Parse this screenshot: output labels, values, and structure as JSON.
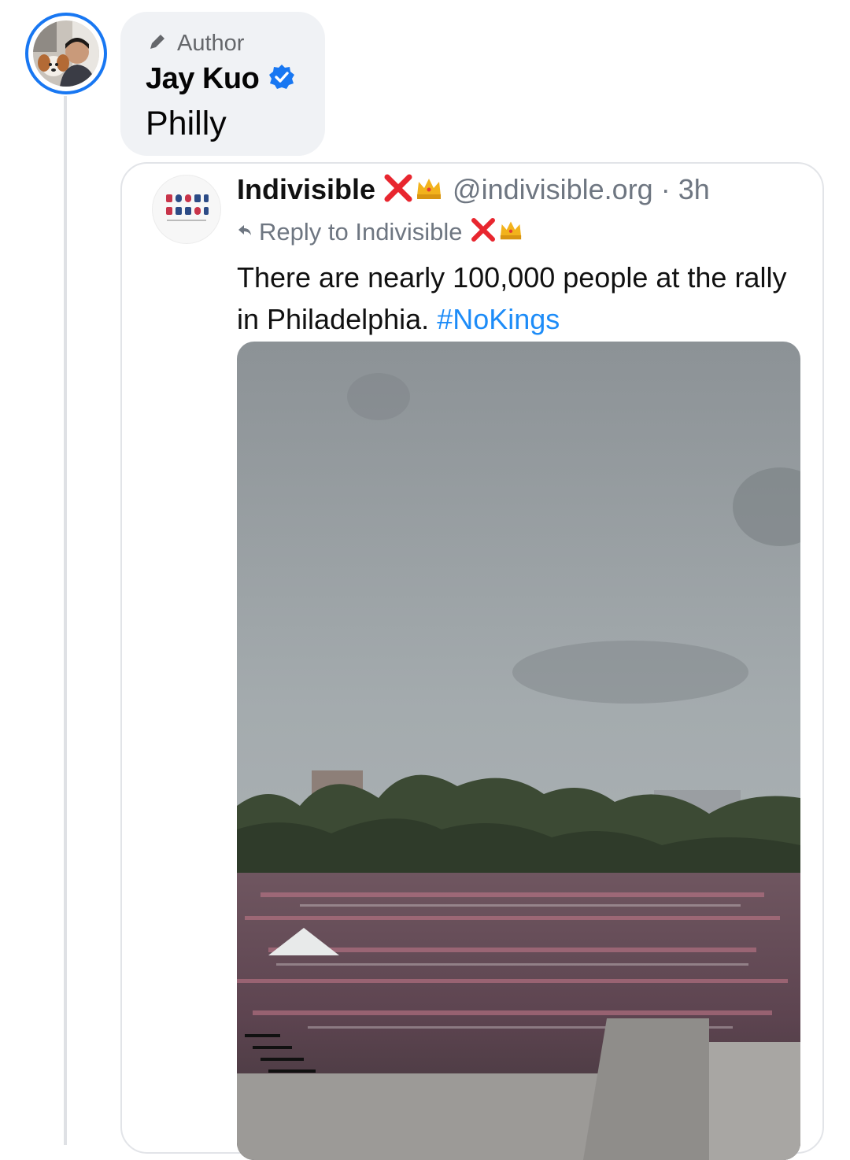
{
  "comment": {
    "author_badge": "Author",
    "author_name": "Jay Kuo",
    "text": "Philly",
    "avatar_icon": "user-avatar-photo",
    "verified_icon": "verified-badge-icon",
    "accent": "#1877f2"
  },
  "embedded_post": {
    "org_name": "Indivisible",
    "handle_time": "@indivisible.org · 3h",
    "reply_label": "Reply to Indivisible",
    "text_before": "There are nearly 100,000 people at the rally in Philadelphia. ",
    "hashtag": "#NoKings",
    "hashtag_color": "#1d8cf8",
    "photo_description_icon": "rally-crowd-photo"
  }
}
